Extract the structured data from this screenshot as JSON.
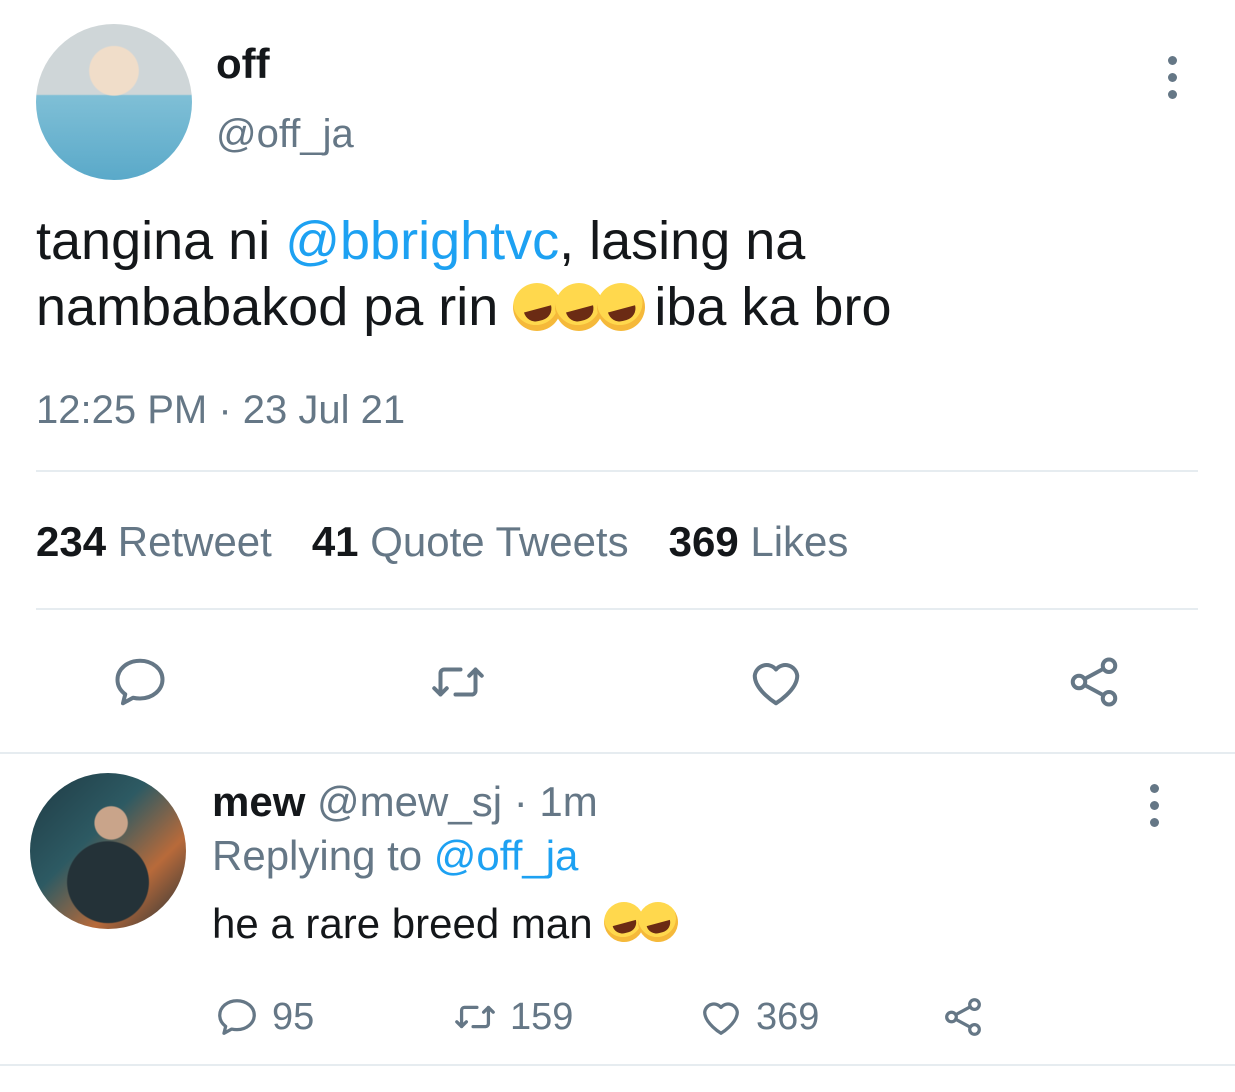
{
  "tweet": {
    "author_name": "off",
    "author_handle": "@off_ja",
    "text_part1": "tangina ni ",
    "mention": "@bbrightvc",
    "text_part2": ", lasing na",
    "text_line2": "nambabakod pa rin ",
    "text_after_emoji": " iba ka bro",
    "timestamp": "12:25 PM · 23 Jul 21",
    "stats": {
      "retweets_count": "234",
      "retweets_label": "Retweet",
      "quotes_count": "41",
      "quotes_label": "Quote Tweets",
      "likes_count": "369",
      "likes_label": "Likes"
    }
  },
  "reply": {
    "author_name": "mew",
    "author_handle": "@mew_sj",
    "time": "· 1m",
    "replying_prefix": "Replying to ",
    "replying_to": "@off_ja",
    "text": "he a rare breed man ",
    "reply_count": "95",
    "retweet_count": "159",
    "like_count": "369"
  },
  "icons": {
    "reply": "reply-icon",
    "retweet": "retweet-icon",
    "like": "heart-icon",
    "share": "share-icon",
    "more": "more-icon"
  },
  "colors": {
    "accent": "#1da1f2",
    "muted": "#657786",
    "text": "#14171a"
  }
}
